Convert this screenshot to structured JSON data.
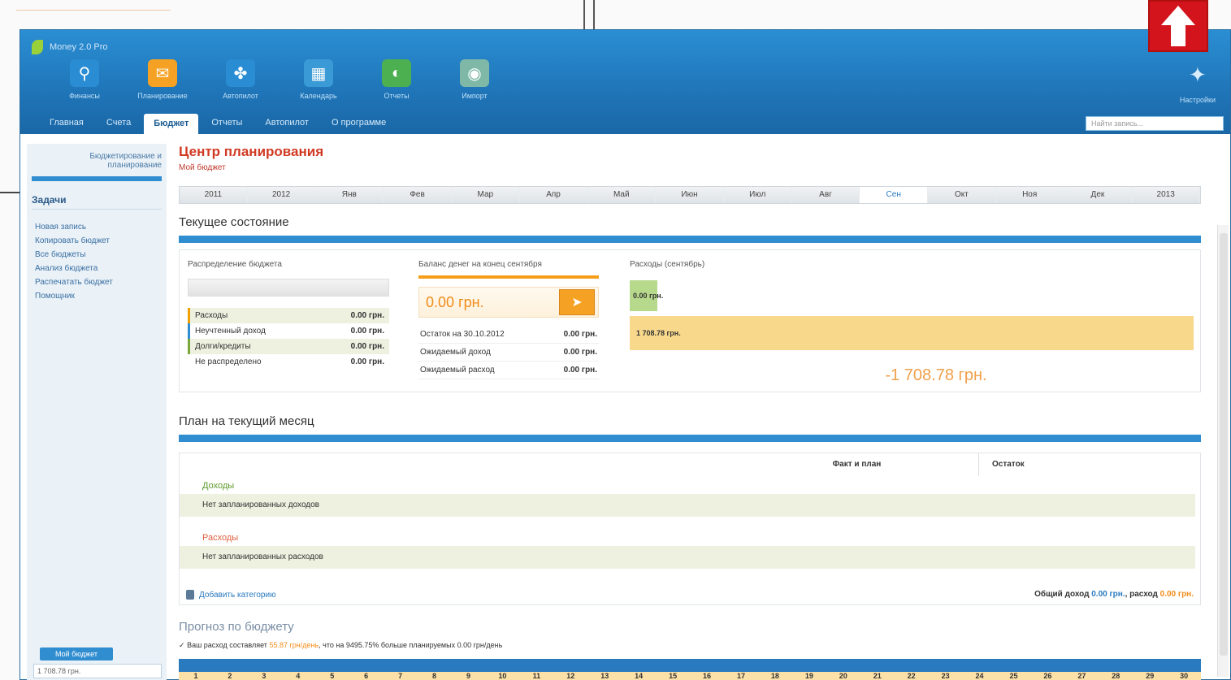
{
  "app": {
    "title": "Money 2.0 Pro"
  },
  "toolbar": [
    {
      "label": "Финансы",
      "icon": "flask-icon",
      "color": "#2a8cd3"
    },
    {
      "label": "Планирование",
      "icon": "mail-icon",
      "color": "#f5a123"
    },
    {
      "label": "Автопилот",
      "icon": "runner-icon",
      "color": "#2a8cd3"
    },
    {
      "label": "Календарь",
      "icon": "calendar-icon",
      "color": "#3a9ad6"
    },
    {
      "label": "Отчеты",
      "icon": "pie-icon",
      "color": "#4caf50"
    },
    {
      "label": "Импорт",
      "icon": "globe-icon",
      "color": "#7fb8a6"
    }
  ],
  "tools_right": {
    "label": "Настройки",
    "icon": "wrench-icon"
  },
  "tabs": [
    "Главная",
    "Счета",
    "Бюджет",
    "Отчеты",
    "Автопилот",
    "О программе"
  ],
  "active_tab": 2,
  "search": {
    "placeholder": "Найти запись..."
  },
  "sidebar": {
    "head": "Бюджетирование и планирование",
    "section": "Задачи",
    "items": [
      "Новая запись",
      "Копировать бюджет",
      "Все бюджеты",
      "Анализ бюджета",
      "Распечатать бюджет",
      "Помощник"
    ],
    "bottom_button": "Мой бюджет",
    "bottom_field": "1 708.78 грн."
  },
  "main": {
    "title": "Центр планирования",
    "subtitle": "Мой бюджет",
    "months": [
      "2011",
      "2012",
      "Янв",
      "Фев",
      "Мар",
      "Апр",
      "Май",
      "Июн",
      "Июл",
      "Авг",
      "Сен",
      "Окт",
      "Ноя",
      "Дек",
      "2013"
    ],
    "active_month": 10
  },
  "state": {
    "title": "Текущее состояние",
    "col1": {
      "head": "Распределение бюджета",
      "rows": [
        {
          "label": "Расходы",
          "amount": "0.00 грн."
        },
        {
          "label": "Неучтенный доход",
          "amount": "0.00 грн."
        },
        {
          "label": "Долги/кредиты",
          "amount": "0.00 грн."
        },
        {
          "label": "Не распределено",
          "amount": "0.00 грн."
        }
      ]
    },
    "col2": {
      "head": "Баланс денег на конец сентября",
      "balance": "0.00 грн.",
      "button_icon": "arrow-right-icon",
      "rows": [
        {
          "label": "Остаток на 30.10.2012",
          "amount": "0.00 грн."
        },
        {
          "label": "Ожидаемый доход",
          "amount": "0.00 грн."
        },
        {
          "label": "Ожидаемый расход",
          "amount": "0.00 грн."
        }
      ]
    },
    "col3": {
      "head": "Расходы (сентябрь)",
      "bar_green": "0.00 грн.",
      "bar_yellow": "1 708.78 грн.",
      "total": "-1 708.78 грн."
    }
  },
  "plan": {
    "title": "План на текущий месяц",
    "headers": [
      "",
      "Факт и план",
      "Остаток"
    ],
    "income_label": "Доходы",
    "income_empty": "Нет запланированных доходов",
    "expense_label": "Расходы",
    "expense_empty": "Нет запланированных расходов",
    "add_button": "Добавить категорию",
    "totals_prefix": "Общий доход",
    "totals_income": "0.00 грн.",
    "totals_mid": ", расход",
    "totals_expense": "0.00 грн."
  },
  "forecast": {
    "title": "Прогноз по бюджету",
    "note_prefix": "Ваш расход составляет",
    "note_hl": "55.87 грн/день",
    "note_suffix": ", что на 9495.75% больше планируемых 0.00 грн/день"
  },
  "days": [
    "1",
    "2",
    "3",
    "4",
    "5",
    "6",
    "7",
    "8",
    "9",
    "10",
    "11",
    "12",
    "13",
    "14",
    "15",
    "16",
    "17",
    "18",
    "19",
    "20",
    "21",
    "22",
    "23",
    "24",
    "25",
    "26",
    "27",
    "28",
    "29",
    "30"
  ]
}
